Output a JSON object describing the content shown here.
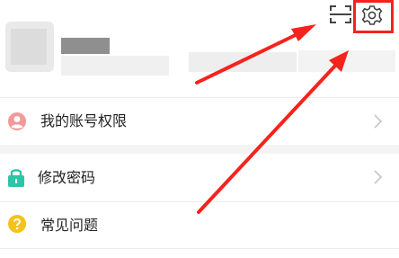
{
  "rows": [
    {
      "label": "我的账号权限",
      "icon": "user-icon",
      "has_chevron": true
    },
    {
      "label": "修改密码",
      "icon": "lock-icon",
      "has_chevron": true
    },
    {
      "label": "常见问题",
      "icon": "question-icon",
      "has_chevron": false
    }
  ],
  "colors": {
    "user_icon": "#f19a9a",
    "lock_icon": "#2ec4a6",
    "question_icon": "#f5c21b",
    "highlight": "#f5231d",
    "arrow": "#f5231d",
    "chevron": "#c8c8c8"
  },
  "icons": {
    "scan": "scan-icon",
    "settings": "gear-icon"
  }
}
